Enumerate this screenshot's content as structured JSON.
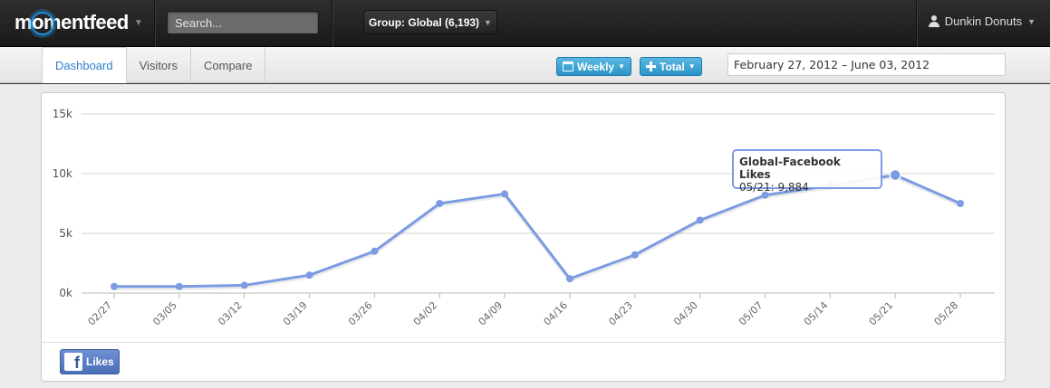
{
  "app": {
    "logo_text_a": "m",
    "logo_text_o": "o",
    "logo_text_b": "mentfeed"
  },
  "nav": {
    "search_placeholder": "Search...",
    "group_label": "Group: Global (6,193)",
    "user_name": "Dunkin Donuts"
  },
  "tabs": [
    {
      "label": "Dashboard",
      "active": true
    },
    {
      "label": "Visitors",
      "active": false
    },
    {
      "label": "Compare",
      "active": false
    }
  ],
  "toolbar": {
    "period_label": "Weekly",
    "metric_label": "Total",
    "date_range": "February 27, 2012 – June 03, 2012"
  },
  "colors": {
    "accent": "#2a7fc9",
    "line": "#7b9be2",
    "button": "#2b93c7",
    "facebook": "#4a6fb8"
  },
  "tooltip": {
    "title": "Global-Facebook Likes",
    "text": "05/21: 9,884"
  },
  "legend": {
    "likes_label": "Likes",
    "icon": "facebook-icon"
  },
  "chart_data": {
    "type": "line",
    "categories": [
      "02/27",
      "03/05",
      "03/12",
      "03/19",
      "03/26",
      "04/02",
      "04/09",
      "04/16",
      "04/23",
      "04/30",
      "05/07",
      "05/14",
      "05/21",
      "05/28"
    ],
    "series": [
      {
        "name": "Global-Facebook Likes",
        "values": [
          550,
          550,
          650,
          1500,
          3500,
          7500,
          8300,
          1200,
          3200,
          6100,
          8200,
          9000,
          9884,
          7500
        ]
      }
    ],
    "ytick_labels": [
      "0k",
      "5k",
      "10k",
      "15k"
    ],
    "ylim": [
      0,
      15000
    ],
    "grid": true,
    "highlight_index": 12
  }
}
